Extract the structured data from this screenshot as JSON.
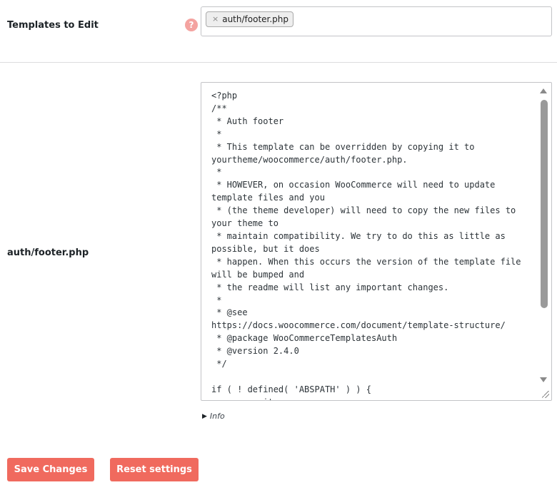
{
  "templates_row": {
    "label": "Templates to Edit",
    "help_icon": "question-icon",
    "help_symbol": "?",
    "selected": [
      {
        "remove_symbol": "×",
        "label": "auth/footer.php"
      }
    ]
  },
  "file_row": {
    "label": "auth/footer.php",
    "code": "<?php\n/**\n * Auth footer\n *\n * This template can be overridden by copying it to yourtheme/woocommerce/auth/footer.php.\n *\n * HOWEVER, on occasion WooCommerce will need to update template files and you\n * (the theme developer) will need to copy the new files to your theme to\n * maintain compatibility. We try to do this as little as possible, but it does\n * happen. When this occurs the version of the template file will be bumped and\n * the readme will list any important changes.\n *\n * @see         https://docs.woocommerce.com/document/template-structure/\n * @package WooCommerceTemplatesAuth\n * @version 2.4.0\n */\n\nif ( ! defined( 'ABSPATH' ) ) {\n\texit;\n}",
    "info_label": "Info"
  },
  "actions": {
    "save_label": "Save Changes",
    "reset_label": "Reset settings"
  },
  "colors": {
    "accent": "#f06a5e",
    "help_icon": "#f4a3a0"
  }
}
